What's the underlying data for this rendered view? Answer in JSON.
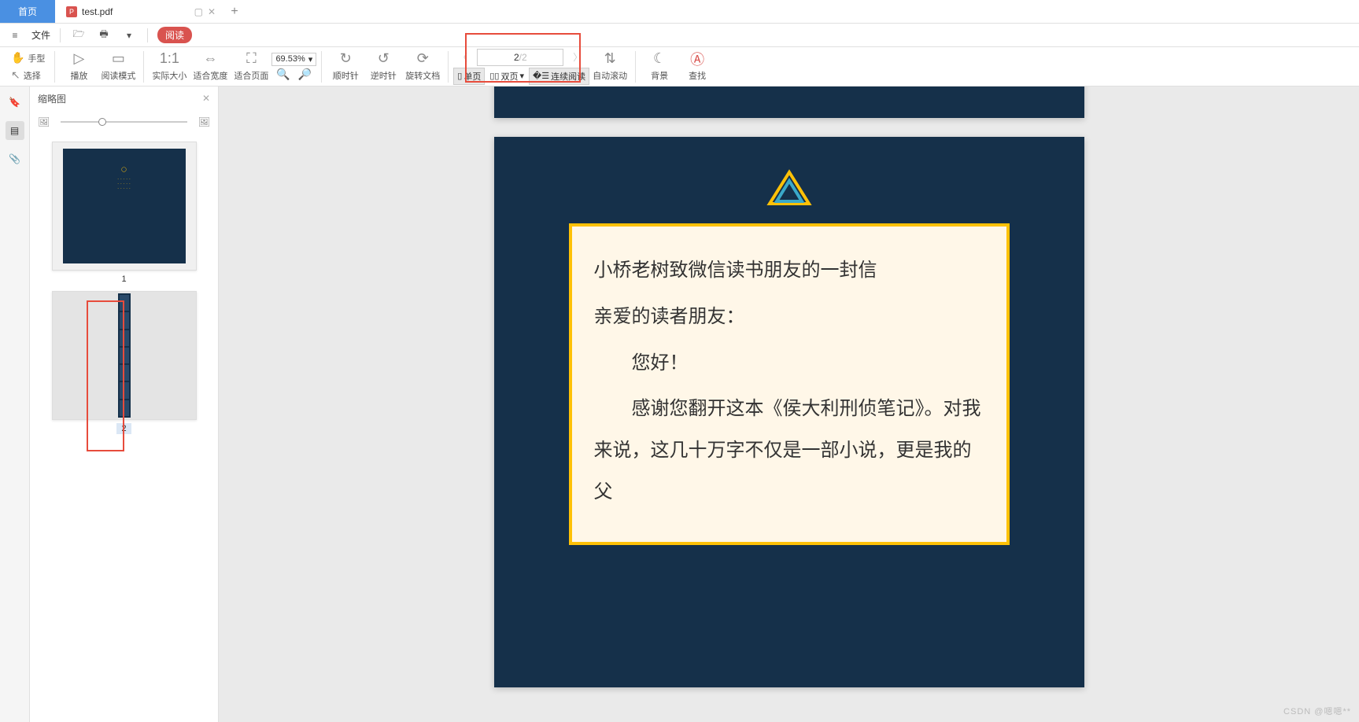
{
  "tabs": {
    "home": "首页",
    "file": "test.pdf",
    "pdf_badge": "P"
  },
  "menubar": {
    "menu_label": "文件",
    "read_badge": "阅读"
  },
  "toolbar": {
    "hand": "手型",
    "select": "选择",
    "play": "播放",
    "read_mode": "阅读模式",
    "actual_size": "实际大小",
    "fit_width": "适合宽度",
    "fit_page": "适合页面",
    "zoom_value": "69.53%",
    "cw": "顺时针",
    "ccw": "逆时针",
    "rotate_doc": "旋转文档",
    "page_current": "2",
    "page_total": "/2",
    "single": "单页",
    "double": "双页",
    "cont": "连续阅读",
    "auto_scroll": "自动滚动",
    "background": "背景",
    "find": "查找"
  },
  "sidebar": {
    "title": "缩略图",
    "pages": [
      "1",
      "2"
    ]
  },
  "viewer": {
    "page2": {
      "title": "小桥老树致微信读书朋友的一封信",
      "greeting": "亲爱的读者朋友：",
      "hello": "　　您好！",
      "body": "　　感谢您翻开这本《侯大利刑侦笔记》。对我来说，这几十万字不仅是一部小说，更是我的父"
    }
  },
  "watermark": "CSDN @嗯嗯**"
}
